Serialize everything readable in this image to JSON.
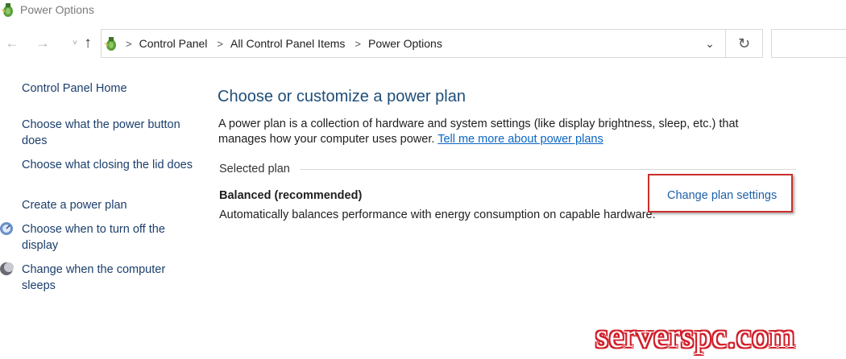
{
  "window": {
    "title": "Power Options"
  },
  "nav": {
    "back_icon": "back-arrow-icon",
    "forward_icon": "forward-arrow-icon",
    "recent_icon": "chevron-down-icon",
    "up_icon": "up-arrow-icon"
  },
  "address": {
    "crumbs": [
      "Control Panel",
      "All Control Panel Items",
      "Power Options"
    ],
    "dropdown_icon": "chevron-down-icon",
    "refresh_icon": "refresh-icon"
  },
  "sidebar": {
    "home": "Control Panel Home",
    "links": [
      "Choose what the power button does",
      "Choose what closing the lid does",
      "Create a power plan",
      "Choose when to turn off the display",
      "Change when the computer sleeps"
    ]
  },
  "main": {
    "title": "Choose or customize a power plan",
    "description": "A power plan is a collection of hardware and system settings (like display brightness, sleep, etc.) that manages how your computer uses power.",
    "learn_more": "Tell me more about power plans",
    "section_header": "Selected plan",
    "plan_name": "Balanced (recommended)",
    "plan_description": "Automatically balances performance with energy consumption on capable hardware.",
    "change_link": "Change plan settings"
  },
  "watermark": "serverspc.com",
  "colors": {
    "link": "#1e5fa8",
    "title": "#1e4e79",
    "highlight": "#c9302c",
    "watermark": "#d21f2a"
  }
}
